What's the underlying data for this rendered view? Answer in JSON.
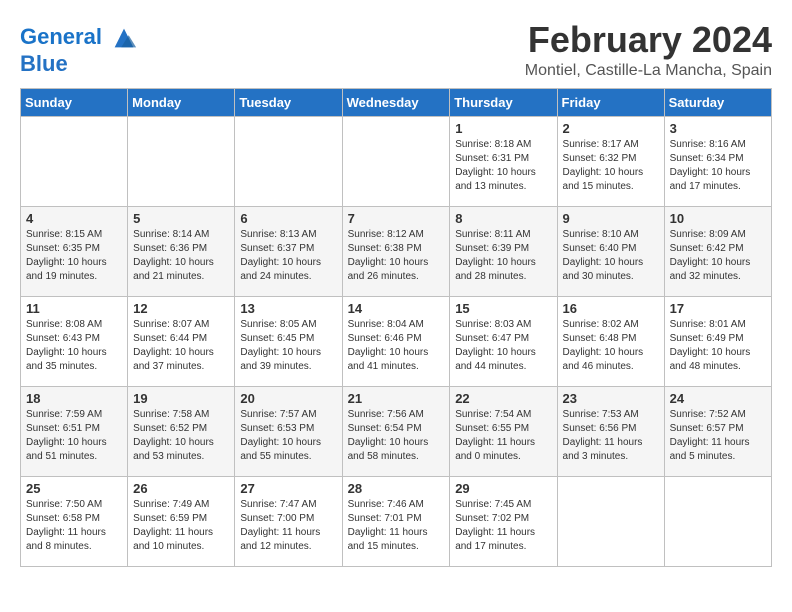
{
  "header": {
    "logo_line1": "General",
    "logo_line2": "Blue",
    "month_title": "February 2024",
    "location": "Montiel, Castille-La Mancha, Spain"
  },
  "weekdays": [
    "Sunday",
    "Monday",
    "Tuesday",
    "Wednesday",
    "Thursday",
    "Friday",
    "Saturday"
  ],
  "weeks": [
    [
      {
        "day": "",
        "info": ""
      },
      {
        "day": "",
        "info": ""
      },
      {
        "day": "",
        "info": ""
      },
      {
        "day": "",
        "info": ""
      },
      {
        "day": "1",
        "info": "Sunrise: 8:18 AM\nSunset: 6:31 PM\nDaylight: 10 hours\nand 13 minutes."
      },
      {
        "day": "2",
        "info": "Sunrise: 8:17 AM\nSunset: 6:32 PM\nDaylight: 10 hours\nand 15 minutes."
      },
      {
        "day": "3",
        "info": "Sunrise: 8:16 AM\nSunset: 6:34 PM\nDaylight: 10 hours\nand 17 minutes."
      }
    ],
    [
      {
        "day": "4",
        "info": "Sunrise: 8:15 AM\nSunset: 6:35 PM\nDaylight: 10 hours\nand 19 minutes."
      },
      {
        "day": "5",
        "info": "Sunrise: 8:14 AM\nSunset: 6:36 PM\nDaylight: 10 hours\nand 21 minutes."
      },
      {
        "day": "6",
        "info": "Sunrise: 8:13 AM\nSunset: 6:37 PM\nDaylight: 10 hours\nand 24 minutes."
      },
      {
        "day": "7",
        "info": "Sunrise: 8:12 AM\nSunset: 6:38 PM\nDaylight: 10 hours\nand 26 minutes."
      },
      {
        "day": "8",
        "info": "Sunrise: 8:11 AM\nSunset: 6:39 PM\nDaylight: 10 hours\nand 28 minutes."
      },
      {
        "day": "9",
        "info": "Sunrise: 8:10 AM\nSunset: 6:40 PM\nDaylight: 10 hours\nand 30 minutes."
      },
      {
        "day": "10",
        "info": "Sunrise: 8:09 AM\nSunset: 6:42 PM\nDaylight: 10 hours\nand 32 minutes."
      }
    ],
    [
      {
        "day": "11",
        "info": "Sunrise: 8:08 AM\nSunset: 6:43 PM\nDaylight: 10 hours\nand 35 minutes."
      },
      {
        "day": "12",
        "info": "Sunrise: 8:07 AM\nSunset: 6:44 PM\nDaylight: 10 hours\nand 37 minutes."
      },
      {
        "day": "13",
        "info": "Sunrise: 8:05 AM\nSunset: 6:45 PM\nDaylight: 10 hours\nand 39 minutes."
      },
      {
        "day": "14",
        "info": "Sunrise: 8:04 AM\nSunset: 6:46 PM\nDaylight: 10 hours\nand 41 minutes."
      },
      {
        "day": "15",
        "info": "Sunrise: 8:03 AM\nSunset: 6:47 PM\nDaylight: 10 hours\nand 44 minutes."
      },
      {
        "day": "16",
        "info": "Sunrise: 8:02 AM\nSunset: 6:48 PM\nDaylight: 10 hours\nand 46 minutes."
      },
      {
        "day": "17",
        "info": "Sunrise: 8:01 AM\nSunset: 6:49 PM\nDaylight: 10 hours\nand 48 minutes."
      }
    ],
    [
      {
        "day": "18",
        "info": "Sunrise: 7:59 AM\nSunset: 6:51 PM\nDaylight: 10 hours\nand 51 minutes."
      },
      {
        "day": "19",
        "info": "Sunrise: 7:58 AM\nSunset: 6:52 PM\nDaylight: 10 hours\nand 53 minutes."
      },
      {
        "day": "20",
        "info": "Sunrise: 7:57 AM\nSunset: 6:53 PM\nDaylight: 10 hours\nand 55 minutes."
      },
      {
        "day": "21",
        "info": "Sunrise: 7:56 AM\nSunset: 6:54 PM\nDaylight: 10 hours\nand 58 minutes."
      },
      {
        "day": "22",
        "info": "Sunrise: 7:54 AM\nSunset: 6:55 PM\nDaylight: 11 hours\nand 0 minutes."
      },
      {
        "day": "23",
        "info": "Sunrise: 7:53 AM\nSunset: 6:56 PM\nDaylight: 11 hours\nand 3 minutes."
      },
      {
        "day": "24",
        "info": "Sunrise: 7:52 AM\nSunset: 6:57 PM\nDaylight: 11 hours\nand 5 minutes."
      }
    ],
    [
      {
        "day": "25",
        "info": "Sunrise: 7:50 AM\nSunset: 6:58 PM\nDaylight: 11 hours\nand 8 minutes."
      },
      {
        "day": "26",
        "info": "Sunrise: 7:49 AM\nSunset: 6:59 PM\nDaylight: 11 hours\nand 10 minutes."
      },
      {
        "day": "27",
        "info": "Sunrise: 7:47 AM\nSunset: 7:00 PM\nDaylight: 11 hours\nand 12 minutes."
      },
      {
        "day": "28",
        "info": "Sunrise: 7:46 AM\nSunset: 7:01 PM\nDaylight: 11 hours\nand 15 minutes."
      },
      {
        "day": "29",
        "info": "Sunrise: 7:45 AM\nSunset: 7:02 PM\nDaylight: 11 hours\nand 17 minutes."
      },
      {
        "day": "",
        "info": ""
      },
      {
        "day": "",
        "info": ""
      }
    ]
  ]
}
